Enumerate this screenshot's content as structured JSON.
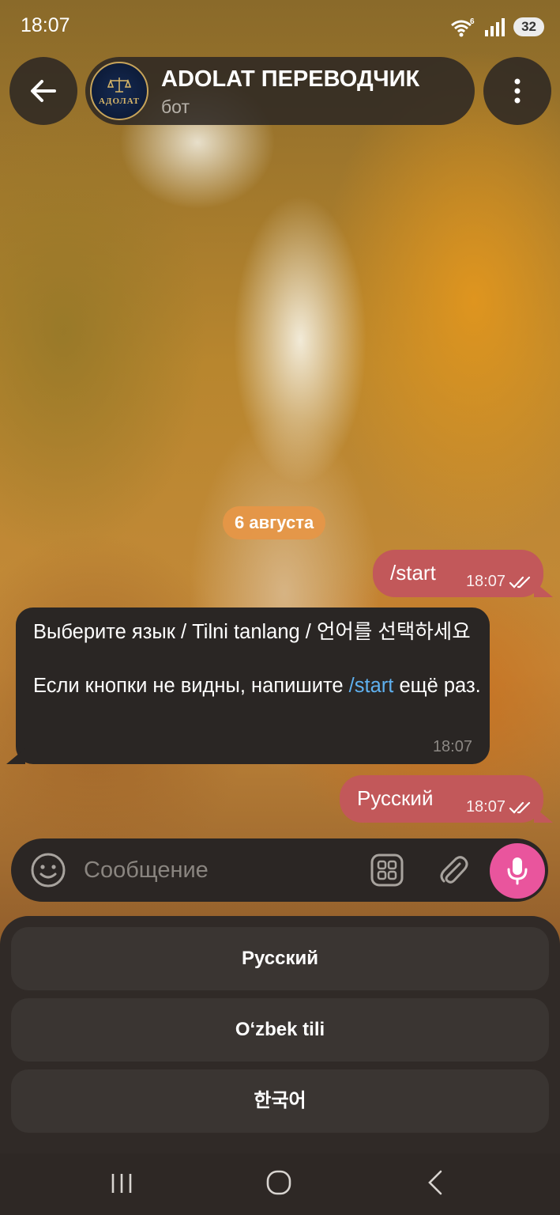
{
  "status_bar": {
    "time": "18:07",
    "wifi_badge": "6",
    "battery": "32"
  },
  "header": {
    "title": "ADOLAT ПЕРЕВОДЧИК",
    "subtitle": "бот",
    "avatar_logo_text": "АДОЛАТ",
    "back_icon": "arrow-left-icon",
    "menu_icon": "more-vertical-icon"
  },
  "chat": {
    "date": "6 августа",
    "messages": [
      {
        "direction": "out",
        "text": "/start",
        "time": "18:07",
        "status": "read"
      },
      {
        "direction": "in",
        "line1": "Выберите язык / Tilni tanlang / 언어를 선택하세요",
        "line2_prefix": "Если кнопки не видны, напишите ",
        "line2_link": "/start",
        "line2_suffix": " ещё раз.",
        "time": "18:07"
      },
      {
        "direction": "out",
        "text": "Русский",
        "time": "18:07",
        "status": "read"
      }
    ]
  },
  "composer": {
    "placeholder": "Сообщение",
    "emoji_icon": "emoji-icon",
    "keyboard_icon": "keyboard-toggle-icon",
    "attach_icon": "paperclip-icon",
    "mic_icon": "microphone-icon",
    "mic_color": "#e9559d"
  },
  "reply_keyboard": {
    "buttons": [
      "Русский",
      "Oʻzbek tili",
      "한국어"
    ]
  },
  "colors": {
    "outgoing_bubble": "#c2585a",
    "incoming_bubble": "#2a2624",
    "date_chip": "#e6964a",
    "link": "#5fb0ee"
  }
}
